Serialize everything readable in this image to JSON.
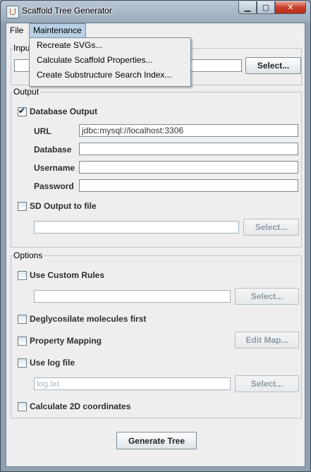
{
  "window": {
    "title": "Scaffold Tree Generator",
    "minimize": "▁",
    "maximize": "▢",
    "close": "✕"
  },
  "menubar": {
    "file": "File",
    "maintenance": "Maintenance"
  },
  "maintenance_menu": {
    "items": [
      "Recreate SVGs...",
      "Calculate Scaffold Properties...",
      "Create Substructure Search Index..."
    ]
  },
  "input": {
    "legend": "Input",
    "select_label": "Select..."
  },
  "output": {
    "legend": "Output",
    "database_output_label": "Database Output",
    "database_output_checked": true,
    "url_label": "URL",
    "url_value": "jdbc:mysql://localhost:3306",
    "database_label": "Database",
    "database_value": "",
    "username_label": "Username",
    "username_value": "",
    "password_label": "Password",
    "password_value": "",
    "sd_output_label": "SD Output to file",
    "sd_output_checked": false,
    "sd_path_value": "",
    "sd_select_label": "Select..."
  },
  "options": {
    "legend": "Options",
    "custom_rules_label": "Use Custom Rules",
    "custom_rules_checked": false,
    "custom_rules_path": "",
    "custom_rules_select_label": "Select...",
    "deglycosilate_label": "Deglycosilate molecules first",
    "deglycosilate_checked": false,
    "property_mapping_label": "Property Mapping",
    "property_mapping_checked": false,
    "edit_map_label": "Edit Map...",
    "log_file_label": "Use log file",
    "log_file_checked": false,
    "log_file_placeholder": "log.txt",
    "log_select_label": "Select...",
    "calc_2d_label": "Calculate 2D coordinates",
    "calc_2d_checked": false
  },
  "actions": {
    "generate_label": "Generate Tree"
  }
}
